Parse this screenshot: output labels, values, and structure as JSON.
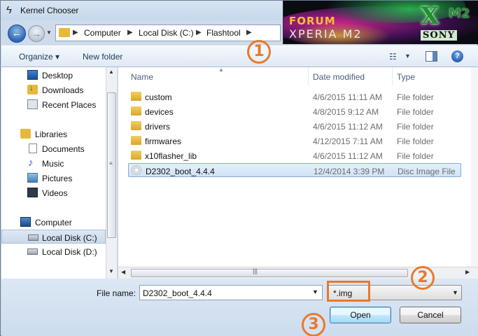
{
  "window": {
    "title": "Kernel Chooser"
  },
  "banner": {
    "forum": "FORUM",
    "xperia": "XPERIA M2",
    "xm_letter": "X",
    "xm_suffix": "M2",
    "sony": "SONY"
  },
  "address": {
    "crumbs": [
      "Computer",
      "Local Disk (C:)",
      "Flashtool"
    ]
  },
  "toolbar": {
    "organize": "Organize ▾",
    "new_folder": "New folder"
  },
  "nav": {
    "items": [
      {
        "label": "Desktop",
        "icon": "desktop-icon"
      },
      {
        "label": "Downloads",
        "icon": "downloads-icon"
      },
      {
        "label": "Recent Places",
        "icon": "recent-places-icon"
      },
      {
        "label": "Libraries",
        "icon": "libraries-icon"
      },
      {
        "label": "Documents",
        "icon": "documents-icon"
      },
      {
        "label": "Music",
        "icon": "music-icon"
      },
      {
        "label": "Pictures",
        "icon": "pictures-icon"
      },
      {
        "label": "Videos",
        "icon": "videos-icon"
      },
      {
        "label": "Computer",
        "icon": "computer-icon"
      },
      {
        "label": "Local Disk (C:)",
        "icon": "disk-icon",
        "selected": true
      },
      {
        "label": "Local Disk (D:)",
        "icon": "disk-icon"
      }
    ]
  },
  "list": {
    "columns": [
      "Name",
      "Date modified",
      "Type"
    ],
    "rows": [
      {
        "name": "custom",
        "date": "4/6/2015 11:11 AM",
        "type": "File folder",
        "icon": "folder-icon"
      },
      {
        "name": "devices",
        "date": "4/8/2015 9:12 AM",
        "type": "File folder",
        "icon": "folder-icon"
      },
      {
        "name": "drivers",
        "date": "4/6/2015 11:12 AM",
        "type": "File folder",
        "icon": "folder-icon"
      },
      {
        "name": "firmwares",
        "date": "4/12/2015 7:11 AM",
        "type": "File folder",
        "icon": "folder-icon"
      },
      {
        "name": "x10flasher_lib",
        "date": "4/6/2015 11:12 AM",
        "type": "File folder",
        "icon": "folder-icon"
      },
      {
        "name": "D2302_boot_4.4.4",
        "date": "12/4/2014 3:39 PM",
        "type": "Disc Image File",
        "icon": "disc-image-icon",
        "selected": true
      }
    ]
  },
  "bottom": {
    "file_name_label": "File name:",
    "file_name_value": "D2302_boot_4.4.4",
    "filter_value": "*.img",
    "open_label": "Open",
    "cancel_label": "Cancel"
  },
  "callouts": [
    "1",
    "2",
    "3"
  ],
  "colors": {
    "callout": "#e9792b",
    "selection": "#cfe3f7"
  }
}
